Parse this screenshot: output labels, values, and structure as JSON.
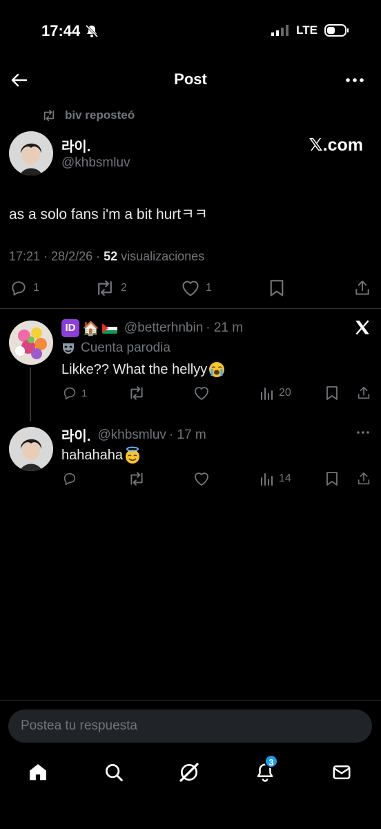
{
  "status_bar": {
    "time": "17:44",
    "network": "LTE"
  },
  "header": {
    "title": "Post"
  },
  "repost": {
    "text": "biv reposteó"
  },
  "main_post": {
    "display_name": "라이.",
    "handle": "@khbsmluv",
    "source": "𝕏.com",
    "text": "as a solo fans i'm a bit hurtㅋㅋ",
    "time": "17:21 · 28/2/26 · ",
    "views_count": "52",
    "views_label": " visualizaciones",
    "replies": "1",
    "reposts": "2",
    "likes": "1"
  },
  "replies": [
    {
      "handle": "@betterhnbin",
      "time": "· 21 m",
      "parody_label": "Cuenta parodia",
      "text": "Likke?? What the hellyy",
      "replies": "1",
      "views": "20"
    },
    {
      "display_name": "라이.",
      "handle": "@khbsmluv",
      "time": "· 17 m",
      "text": "hahahaha",
      "views": "14"
    }
  ],
  "composer": {
    "placeholder": "Postea tu respuesta"
  },
  "nav": {
    "notifications_badge": "3"
  },
  "icons": [
    "back-arrow-icon",
    "more-icon",
    "repost-icon",
    "reply-icon",
    "like-icon",
    "bookmark-icon",
    "share-icon",
    "views-icon",
    "x-logo-icon",
    "home-icon",
    "search-icon",
    "grok-icon",
    "bell-icon",
    "mail-icon"
  ],
  "colors": {
    "background": "#000000",
    "text": "#e7e9ea",
    "muted": "#71767b",
    "accent": "#1d9bf0"
  }
}
